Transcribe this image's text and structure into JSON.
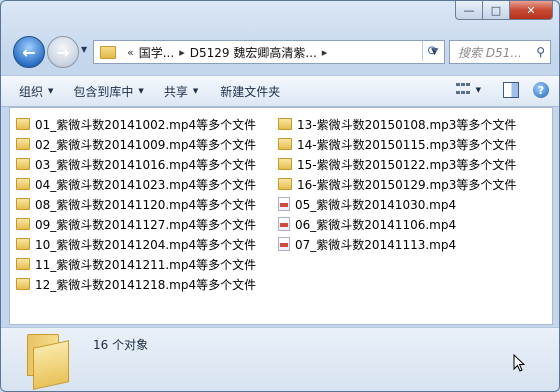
{
  "window": {
    "caption_buttons": [
      "—",
      "□",
      "✕"
    ]
  },
  "nav": {
    "address_crumbs": [
      "«",
      "国学...",
      "D5129 魏宏卿高清紫..."
    ],
    "search_placeholder": "搜索 D51..."
  },
  "toolbar": {
    "organize": "组织",
    "include_in_library": "包含到库中",
    "share": "共享",
    "new_folder": "新建文件夹"
  },
  "files_left": [
    {
      "name": "01_紫微斗数20141002.mp4等多个文件",
      "icon": "folder-icon"
    },
    {
      "name": "02_紫微斗数20141009.mp4等多个文件",
      "icon": "folder-icon"
    },
    {
      "name": "03_紫微斗数20141016.mp4等多个文件",
      "icon": "folder-icon"
    },
    {
      "name": "04_紫微斗数20141023.mp4等多个文件",
      "icon": "folder-icon"
    },
    {
      "name": "08_紫微斗数20141120.mp4等多个文件",
      "icon": "folder-icon"
    },
    {
      "name": "09_紫微斗数20141127.mp4等多个文件",
      "icon": "folder-icon"
    },
    {
      "name": "10_紫微斗数20141204.mp4等多个文件",
      "icon": "folder-icon"
    },
    {
      "name": "11_紫微斗数20141211.mp4等多个文件",
      "icon": "folder-icon"
    },
    {
      "name": "12_紫微斗数20141218.mp4等多个文件",
      "icon": "folder-icon"
    }
  ],
  "files_right": [
    {
      "name": "13-紫微斗数20150108.mp3等多个文件",
      "icon": "folder-icon"
    },
    {
      "name": "14-紫微斗数20150115.mp3等多个文件",
      "icon": "folder-icon"
    },
    {
      "name": "15-紫微斗数20150122.mp3等多个文件",
      "icon": "folder-icon"
    },
    {
      "name": "16-紫微斗数20150129.mp3等多个文件",
      "icon": "folder-icon"
    },
    {
      "name": "05_紫微斗数20141030.mp4",
      "icon": "video-file-icon"
    },
    {
      "name": "06_紫微斗数20141106.mp4",
      "icon": "video-file-icon"
    },
    {
      "name": "07_紫微斗数20141113.mp4",
      "icon": "video-file-icon"
    }
  ],
  "details": {
    "count_text": "16 个对象"
  }
}
